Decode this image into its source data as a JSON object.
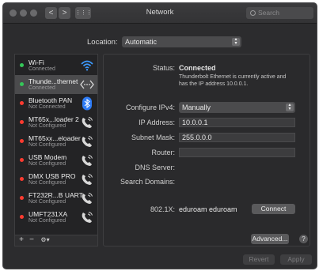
{
  "window": {
    "title": "Network"
  },
  "toolbar": {
    "back": "<",
    "forward": ">",
    "grid": "⋮⋮⋮"
  },
  "search": {
    "placeholder": "Search"
  },
  "location": {
    "label": "Location:",
    "value": "Automatic"
  },
  "services": [
    {
      "name": "Wi-Fi",
      "status": "Connected",
      "dot": "#35c759",
      "icon": "wifi-icon"
    },
    {
      "name": "Thunde...thernet",
      "status": "Connected",
      "dot": "#35c759",
      "icon": "ethernet-icon"
    },
    {
      "name": "Bluetooth PAN",
      "status": "Not Connected",
      "dot": "#ff3b30",
      "icon": "bluetooth-icon"
    },
    {
      "name": "MT65x...loader 2",
      "status": "Not Configured",
      "dot": "#ff3b30",
      "icon": "phone-icon"
    },
    {
      "name": "MT65xx...eloader",
      "status": "Not Configured",
      "dot": "#ff3b30",
      "icon": "phone-icon"
    },
    {
      "name": "USB Modem",
      "status": "Not Configured",
      "dot": "#ff3b30",
      "icon": "phone-icon"
    },
    {
      "name": "DMX USB PRO",
      "status": "Not Configured",
      "dot": "#ff3b30",
      "icon": "phone-icon"
    },
    {
      "name": "FT232R...B UART",
      "status": "Not Configured",
      "dot": "#ff3b30",
      "icon": "phone-icon"
    },
    {
      "name": "UMFT231XA",
      "status": "Not Configured",
      "dot": "#ff3b30",
      "icon": "phone-icon"
    }
  ],
  "sidebar_controls": {
    "add": "+",
    "remove": "−",
    "gear": "⚙▾"
  },
  "detail": {
    "status_label": "Status:",
    "status_value": "Connected",
    "status_desc_1": "Thunderbolt Ethernet is currently active and",
    "status_desc_2": "has the IP address 10.0.0.1.",
    "configure_label": "Configure IPv4:",
    "configure_value": "Manually",
    "ip_label": "IP Address:",
    "ip_value": "10.0.0.1",
    "subnet_label": "Subnet Mask:",
    "subnet_value": "255.0.0.0",
    "router_label": "Router:",
    "router_value": "",
    "dns_label": "DNS Server:",
    "search_domains_label": "Search Domains:",
    "dot1x_label": "802.1X:",
    "dot1x_value": "eduroam eduroam",
    "connect": "Connect",
    "advanced": "Advanced...",
    "help": "?"
  },
  "footer": {
    "revert": "Revert",
    "apply": "Apply"
  }
}
